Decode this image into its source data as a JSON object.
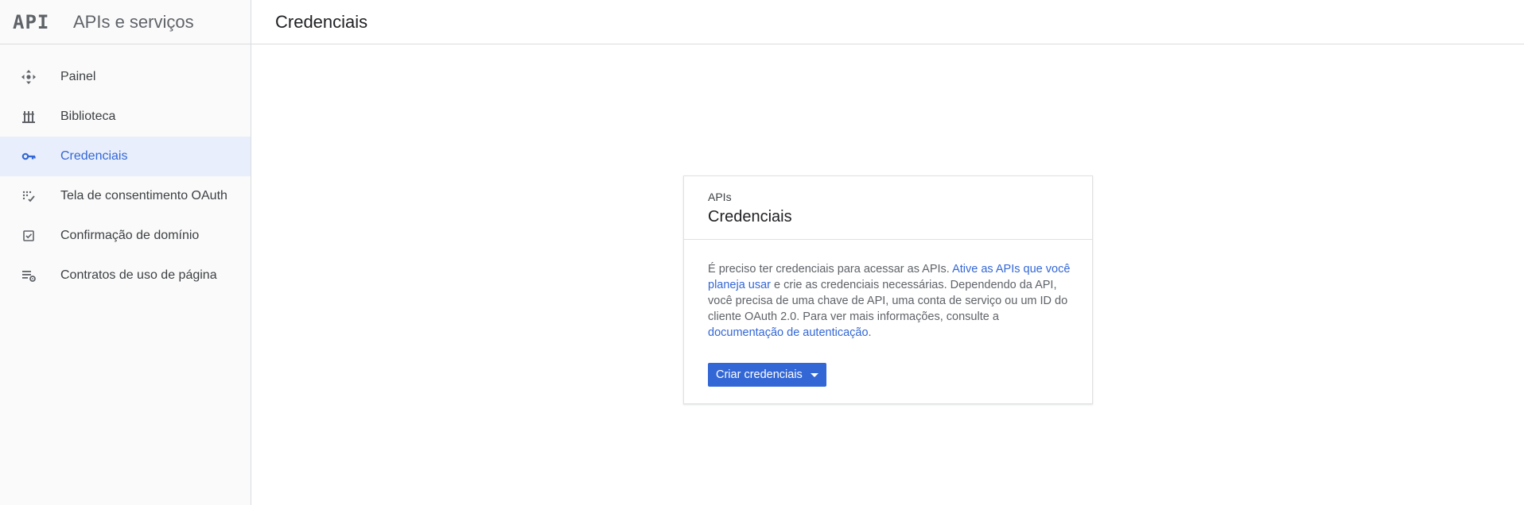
{
  "header": {
    "logo_text": "API",
    "product_title": "APIs e serviços",
    "page_title": "Credenciais"
  },
  "sidebar": {
    "items": [
      {
        "label": "Painel",
        "icon": "dashboard-icon",
        "active": false
      },
      {
        "label": "Biblioteca",
        "icon": "library-icon",
        "active": false
      },
      {
        "label": "Credenciais",
        "icon": "key-icon",
        "active": true
      },
      {
        "label": "Tela de consentimento OAuth",
        "icon": "consent-screen-icon",
        "active": false
      },
      {
        "label": "Confirmação de domínio",
        "icon": "domain-check-icon",
        "active": false
      },
      {
        "label": "Contratos de uso de página",
        "icon": "page-settings-icon",
        "active": false
      }
    ]
  },
  "card": {
    "eyebrow": "APIs",
    "title": "Credenciais",
    "text_1": "É preciso ter credenciais para acessar as APIs. ",
    "link_1": "Ative as APIs que você planeja usar",
    "text_2": " e crie as credenciais necessárias. Dependendo da API, você precisa de uma chave de API, uma conta de serviço ou um ID do cliente OAuth 2.0. Para ver mais informações, consulte a ",
    "link_2": "documentação de autenticação",
    "text_3": ".",
    "button_label": "Criar credenciais"
  },
  "colors": {
    "accent": "#3367d6",
    "active_bg": "#e8eefb",
    "sidebar_bg": "#fafafa",
    "border": "#dadce0"
  }
}
